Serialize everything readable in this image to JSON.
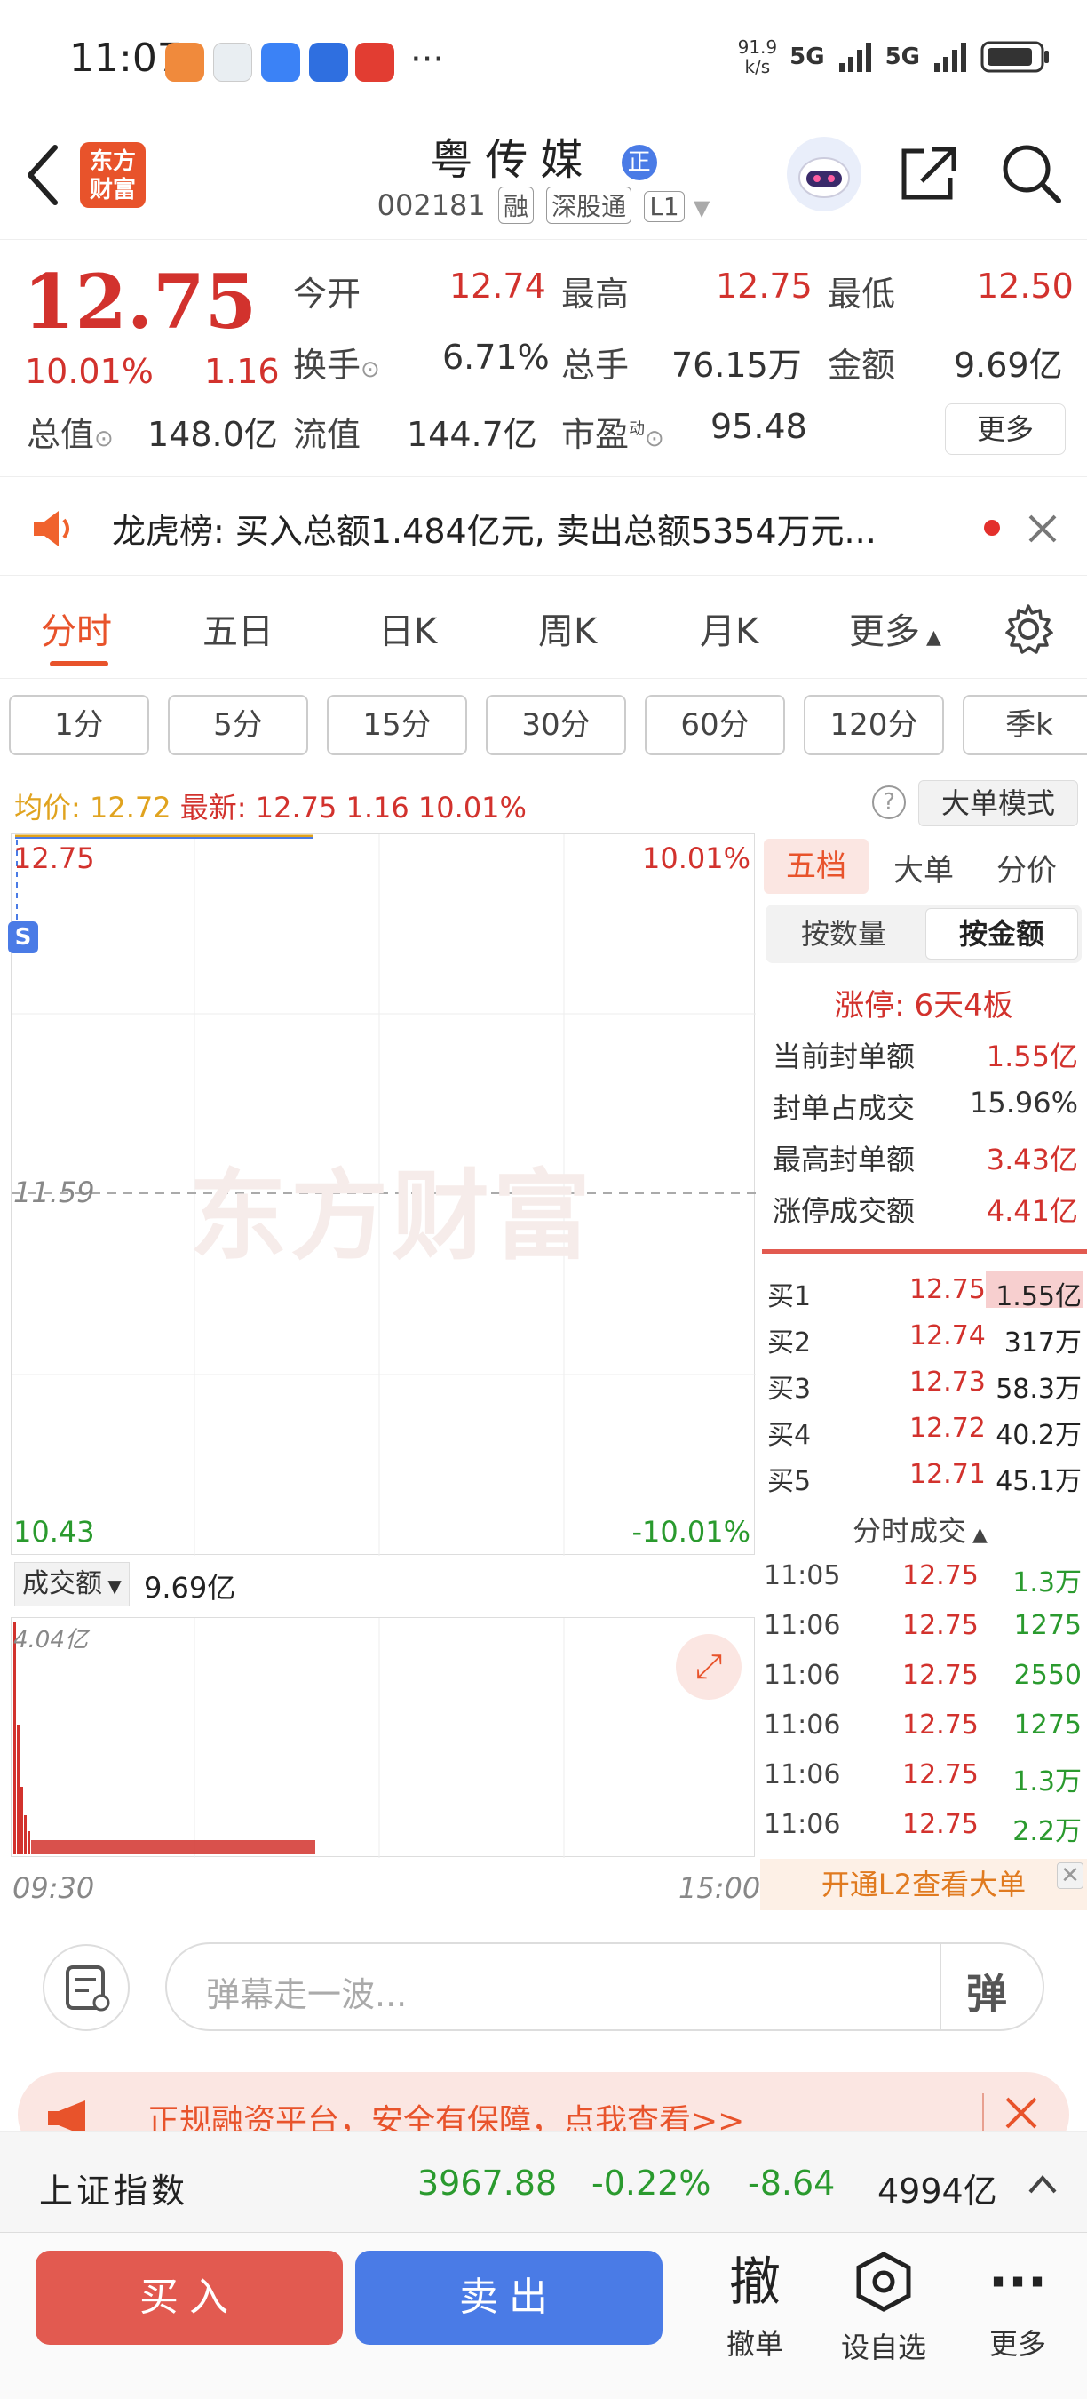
{
  "status": {
    "time": "11:07",
    "speed": "91.9",
    "speed_unit": "k/s",
    "sig1": "5G",
    "sig2": "5G"
  },
  "header": {
    "logo_line1": "东方",
    "logo_line2": "财富",
    "title": "粤传媒",
    "badge": "正",
    "code": "002181",
    "tags": [
      "融",
      "深股通",
      "L1"
    ]
  },
  "quote": {
    "price": "12.75",
    "change_pct": "10.01%",
    "change": "1.16",
    "open_label": "今开",
    "open": "12.74",
    "high_label": "最高",
    "high": "12.75",
    "low_label": "最低",
    "low": "12.50",
    "turnover_label": "换手",
    "turnover": "6.71%",
    "volume_label": "总手",
    "volume": "76.15万",
    "amount_label": "金额",
    "amount": "9.69亿",
    "mktcap_label": "总值",
    "mktcap": "148.0亿",
    "float_label": "流值",
    "float": "144.7亿",
    "pe_label": "市盈",
    "pe_sup": "动",
    "pe": "95.48",
    "more": "更多"
  },
  "notice": {
    "text": "龙虎榜: 买入总额1.484亿元, 卖出总额5354万元..."
  },
  "tabs": [
    "分时",
    "五日",
    "日K",
    "周K",
    "月K",
    "更多"
  ],
  "periods": [
    "1分",
    "5分",
    "15分",
    "30分",
    "60分",
    "120分",
    "季k"
  ],
  "avgline": {
    "avg_label": "均价:",
    "avg": "12.72",
    "last_label": "最新:",
    "last": "12.75",
    "chg": "1.16",
    "pct": "10.01%",
    "mode": "大单模式"
  },
  "chart": {
    "top_price": "12.75",
    "top_pct": "10.01%",
    "mid_price": "11.59",
    "bottom_price": "10.43",
    "bottom_pct": "-10.01%",
    "watermark": "东方财富",
    "vol_label": "成交额",
    "vol_value": "9.69亿",
    "vol_max": "4.04亿",
    "time_start": "09:30",
    "time_end": "15:00",
    "s_badge": "S"
  },
  "panel": {
    "tabs": [
      "五档",
      "大单",
      "分价"
    ],
    "sub_tabs": [
      "按数量",
      "按金额"
    ],
    "limit_title": "涨停: 6天4板",
    "limit_rows": [
      {
        "label": "当前封单额",
        "value": "1.55亿"
      },
      {
        "label": "封单占成交",
        "value": "15.96%"
      },
      {
        "label": "最高封单额",
        "value": "3.43亿"
      },
      {
        "label": "涨停成交额",
        "value": "4.41亿"
      }
    ],
    "bids": [
      {
        "label": "买1",
        "price": "12.75",
        "vol": "1.55亿"
      },
      {
        "label": "买2",
        "price": "12.74",
        "vol": "317万"
      },
      {
        "label": "买3",
        "price": "12.73",
        "vol": "58.3万"
      },
      {
        "label": "买4",
        "price": "12.72",
        "vol": "40.2万"
      },
      {
        "label": "买5",
        "price": "12.71",
        "vol": "45.1万"
      }
    ],
    "ticks_title": "分时成交",
    "ticks": [
      {
        "time": "11:05",
        "price": "12.75",
        "vol": "1.3万"
      },
      {
        "time": "11:06",
        "price": "12.75",
        "vol": "1275"
      },
      {
        "time": "11:06",
        "price": "12.75",
        "vol": "2550"
      },
      {
        "time": "11:06",
        "price": "12.75",
        "vol": "1275"
      },
      {
        "time": "11:06",
        "price": "12.75",
        "vol": "1.3万"
      },
      {
        "time": "11:06",
        "price": "12.75",
        "vol": "2.2万"
      }
    ],
    "l2": "开通L2查看大单"
  },
  "danmu": {
    "placeholder": "弹幕走一波...",
    "btn": "弹"
  },
  "ad": {
    "text": "正规融资平台，安全有保障，点我查看>>"
  },
  "index": {
    "name": "上证指数",
    "value": "3967.88",
    "pct": "-0.22%",
    "chg": "-8.64",
    "amount": "4994亿"
  },
  "actions": {
    "buy": "买入",
    "sell": "卖出",
    "cancel_icon": "撤",
    "cancel": "撤单",
    "watch": "设自选",
    "more": "更多"
  },
  "colors": {
    "up": "#d2322d",
    "down": "#2a9a2e",
    "accent": "#e07a1f",
    "buy": "#e25a50",
    "sell": "#4a7be6"
  }
}
